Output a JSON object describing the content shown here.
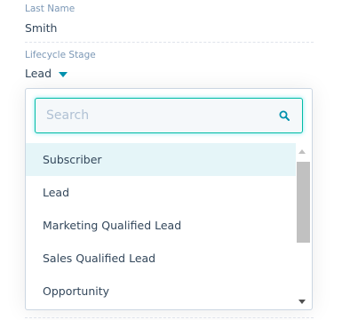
{
  "last_name": {
    "label": "Last Name",
    "value": "Smith"
  },
  "lifecycle_stage": {
    "label": "Lifecycle Stage",
    "value": "Lead",
    "caret_icon": "caret-down-icon"
  },
  "dropdown": {
    "search_placeholder": "Search",
    "search_icon": "search-icon",
    "options": [
      {
        "label": "Subscriber",
        "highlighted": true
      },
      {
        "label": "Lead",
        "highlighted": false
      },
      {
        "label": "Marketing Qualified Lead",
        "highlighted": false
      },
      {
        "label": "Sales Qualified Lead",
        "highlighted": false
      },
      {
        "label": "Opportunity",
        "highlighted": false
      }
    ]
  },
  "colors": {
    "accent": "#0091ae",
    "focus_border": "#00bda5",
    "highlight_bg": "#e5f5f8",
    "text": "#33475b",
    "label": "#7c98b6"
  }
}
